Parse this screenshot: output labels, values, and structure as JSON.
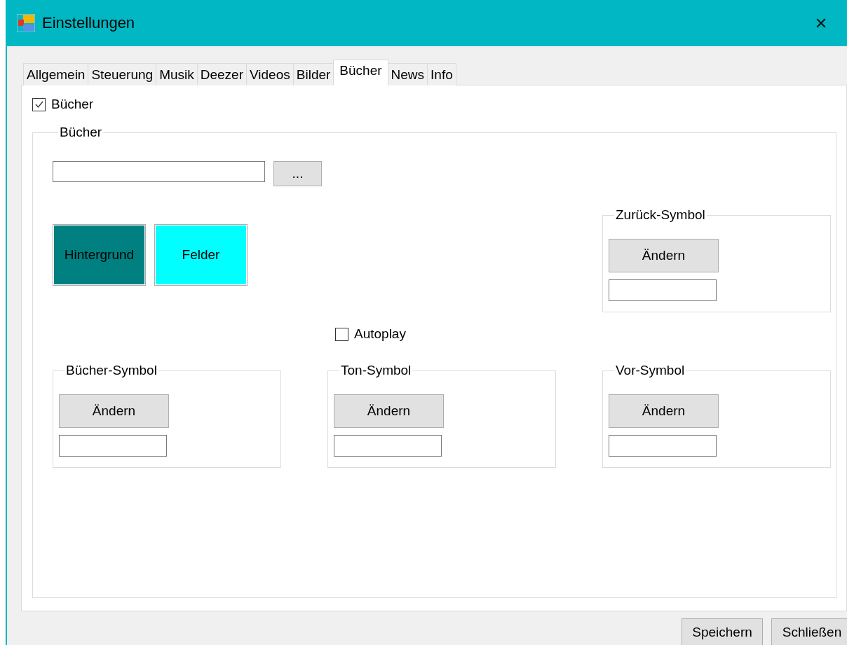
{
  "window": {
    "title": "Einstellungen",
    "close": "✕"
  },
  "tabs": [
    {
      "label": "Allgemein",
      "selected": false
    },
    {
      "label": "Steuerung",
      "selected": false
    },
    {
      "label": "Musik",
      "selected": false
    },
    {
      "label": "Deezer",
      "selected": false
    },
    {
      "label": "Videos",
      "selected": false
    },
    {
      "label": "Bilder",
      "selected": false
    },
    {
      "label": "Bücher",
      "selected": true
    },
    {
      "label": "News",
      "selected": false
    },
    {
      "label": "Info",
      "selected": false
    }
  ],
  "enable": {
    "label": "Bücher",
    "checked": true
  },
  "group": {
    "title": "Bücher",
    "path_button": "...",
    "color_buttons": [
      {
        "label": "Hintergrund",
        "color": "#008080"
      },
      {
        "label": "Felder",
        "color": "#00ffff"
      }
    ],
    "autoplay": {
      "label": "Autoplay",
      "checked": false
    },
    "top_symbol": {
      "title": "Zurück-Symbol",
      "button": "Ändern"
    },
    "symbols": [
      {
        "title": "Bücher-Symbol",
        "button": "Ändern"
      },
      {
        "title": "Ton-Symbol",
        "button": "Ändern"
      },
      {
        "title": "Vor-Symbol",
        "button": "Ändern"
      }
    ]
  },
  "buttons": [
    "Speichern",
    "Schließen"
  ]
}
